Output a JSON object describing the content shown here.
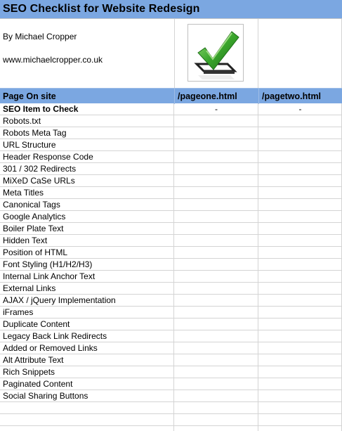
{
  "title": "SEO Checklist for Website Redesign",
  "author": "By Michael Cropper",
  "website": "www.michaelcropper.co.uk",
  "logo_icon": "checkmark-icon",
  "header": {
    "col1": "Page On site",
    "col2": "/pageone.html",
    "col3": "/pagetwo.html"
  },
  "subheader": {
    "label": "SEO Item to Check",
    "col2": "-",
    "col3": "-"
  },
  "items": [
    "Robots.txt",
    "Robots Meta Tag",
    "URL Structure",
    "Header Response Code",
    "301 / 302 Redirects",
    "MiXeD CaSe URLs",
    "Meta Titles",
    "Canonical Tags",
    "Google Analytics",
    "Boiler Plate Text",
    "Hidden Text",
    "Position of HTML",
    "Font Styling (H1/H2/H3)",
    "Internal Link Anchor Text",
    "External Links",
    "AJAX / jQuery Implementation",
    "iFrames",
    "Duplicate Content",
    "Legacy Back Link Redirects",
    "Added or Removed Links",
    "Alt Attribute Text",
    "Rich Snippets",
    "Paginated Content",
    "Social Sharing Buttons"
  ],
  "colors": {
    "header_blue": "#7ba7e1",
    "grid_line": "#d4d4d4",
    "check_green": "#3aa52c"
  }
}
